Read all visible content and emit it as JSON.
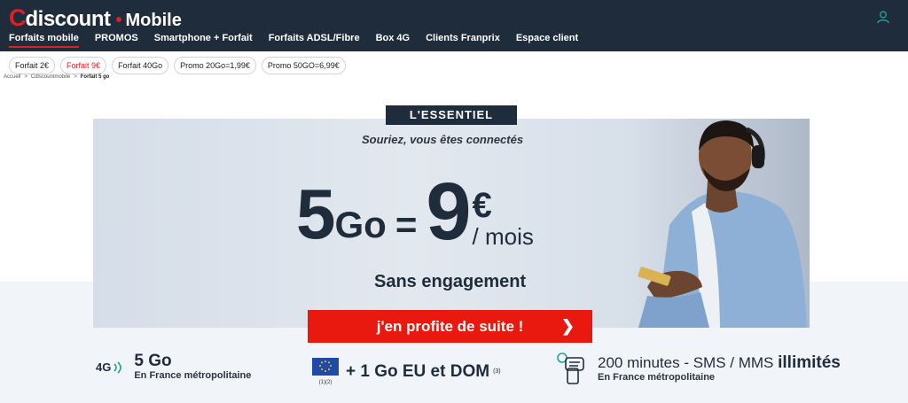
{
  "header": {
    "logo_c": "C",
    "logo_rest": "discount",
    "logo_dot": "•",
    "logo_mobile": "Mobile"
  },
  "nav": {
    "items": [
      {
        "label": "Forfaits mobile",
        "active": true
      },
      {
        "label": "PROMOS"
      },
      {
        "label": "Smartphone + Forfait"
      },
      {
        "label": "Forfaits ADSL/Fibre"
      },
      {
        "label": "Box 4G"
      },
      {
        "label": "Clients Franprix"
      },
      {
        "label": "Espace client"
      }
    ]
  },
  "chips": [
    {
      "label": "Forfait 2€"
    },
    {
      "label": "Forfait 9€",
      "active": true
    },
    {
      "label": "Forfait 40Go"
    },
    {
      "label": "Promo 20Go=1,99€"
    },
    {
      "label": "Promo 50GO=6,99€"
    }
  ],
  "breadcrumb": {
    "home": "Accueil",
    "sep": ">",
    "section": "Cdiscountmobile",
    "current": "Forfait 5 go"
  },
  "offer": {
    "badge": "L'ESSENTIEL",
    "tagline": "Souriez, vous êtes connectés",
    "data_amount": "5",
    "data_unit": "Go",
    "equals": "=",
    "price": "9",
    "currency": "€",
    "period": "/ mois",
    "commitment": "Sans engagement",
    "cta_label": "j'en profite de suite !",
    "cta_arrow": "❯"
  },
  "features": {
    "network": "4G",
    "data_main": "5 Go",
    "data_sub": "En France métropolitaine",
    "eu_main": "+ 1 Go EU et DOM",
    "eu_note": "(3)",
    "eu_flag_caption": "(1)(2)",
    "voice_main": "200 minutes - SMS / MMS ",
    "voice_bold": "illimités",
    "voice_sub": "En France métropolitaine"
  },
  "colors": {
    "header_bg": "#1f2c3b",
    "brand_red": "#e01e25",
    "cta_red": "#e9190f",
    "text_dark": "#1f2c3b",
    "teal_accent": "#1fa39a"
  }
}
